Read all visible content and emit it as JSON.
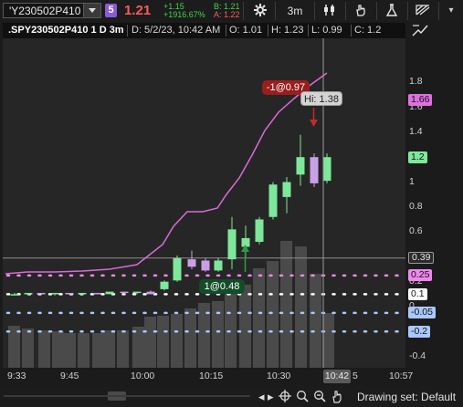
{
  "toolbar": {
    "symbol": "'Y230502P410",
    "badge": "5",
    "last_price": "1.21",
    "change": "+1.15",
    "change_pct": "+1916.67%",
    "bid": "B: 1.21",
    "ask": "A: 1.22",
    "timeframe": "3m"
  },
  "header": {
    "title": ".SPY230502P410 1 D 3m",
    "date": "D: 5/2/23, 10:42 AM",
    "open": "O: 1.01",
    "high": "H: 1.23",
    "low": "L: 0.99",
    "close": "C: 1.2"
  },
  "price_axis": {
    "ticks": [
      "1.8",
      "1.6",
      "1.4",
      "1.2",
      "1",
      "0.8",
      "0.6",
      "0.4",
      "0.2",
      "0",
      "-0.2",
      "-0.4"
    ]
  },
  "price_labels": [
    {
      "text": "1.66",
      "color": "#e070e0"
    },
    {
      "text": "1.2",
      "color": "#7ee89a"
    },
    {
      "text": "0.39",
      "color": "#aaaaaa"
    },
    {
      "text": "0.25",
      "color": "#ee88ee"
    },
    {
      "text": "0.1",
      "color": "#ffffff"
    },
    {
      "text": "-0.05",
      "color": "#a9c8ff"
    },
    {
      "text": "-0.2",
      "color": "#a9c8ff"
    }
  ],
  "time_axis": {
    "ticks": [
      "9:33",
      "9:45",
      "10:00",
      "10:15",
      "10:30",
      "10:45",
      "10:57"
    ],
    "cursor_label": "10:42"
  },
  "annotations": {
    "sell": "-1@0.97",
    "high_bubble": "Hi: 1.38",
    "buy": "1@0.48"
  },
  "footer": {
    "drawing_set": "Drawing set: Default"
  },
  "colors": {
    "bull": "#7ee89a",
    "bear": "#c9a0e8",
    "ma": "#d96ad9",
    "volume": "#4a4a4a"
  }
}
